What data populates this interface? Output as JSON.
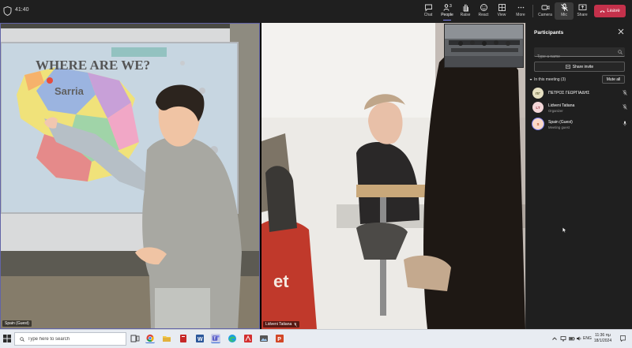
{
  "meeting": {
    "timer": "41:40",
    "toolbar": {
      "chat": "Chat",
      "people": "People",
      "people_count": "3",
      "raise": "Raise",
      "react": "React",
      "view": "View",
      "more": "More",
      "camera": "Camera",
      "mic": "Mic",
      "share": "Share",
      "leave": "Leave"
    }
  },
  "videos": {
    "left_tile_name": "Spain (Guest)",
    "right_tile_name": "Lidveni Tatiana",
    "slide_title": "WHERE ARE WE?",
    "slide_label": "Sarria",
    "poster_text": "et"
  },
  "participants_panel": {
    "title": "Participants",
    "search_placeholder": "Type a name",
    "share_invite": "Share invite",
    "section_label": "In this meeting (3)",
    "mute_all": "Mute all",
    "people": [
      {
        "initials": "ΠΓ",
        "name": "ΠΕΤΡΟΣ ΓΕΩΡΓΙΑΔΗΣ",
        "role": "",
        "avatar_bg": "#e6e0c2",
        "avatar_fg": "#5d5a2e",
        "mic_muted": true
      },
      {
        "initials": "LT",
        "name": "Lidveni Tatiana",
        "role": "Organizer",
        "avatar_bg": "#f3d6d8",
        "avatar_fg": "#a33a46",
        "mic_muted": true
      },
      {
        "initials": "S",
        "name": "Spain (Guest)",
        "role": "Meeting guest",
        "avatar_bg": "#fbd9c8",
        "avatar_fg": "#b24a22",
        "mic_muted": false
      }
    ]
  },
  "taskbar": {
    "search_placeholder": "Type here to search",
    "language": "ENG",
    "time": "11:36 πμ",
    "date": "18/1/2024"
  },
  "colors": {
    "accent": "#6264a7",
    "leave": "#c4314b",
    "panel_bg": "#1f1f1f"
  }
}
